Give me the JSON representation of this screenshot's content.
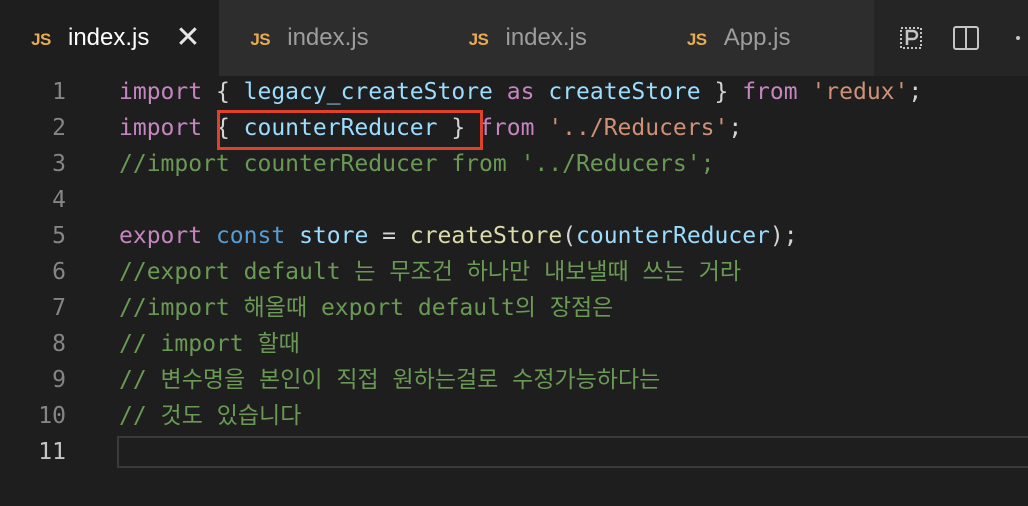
{
  "tabs": [
    {
      "icon": "JS",
      "label": "index.js",
      "active": true,
      "close": "✕"
    },
    {
      "icon": "JS",
      "label": "index.js",
      "active": false
    },
    {
      "icon": "JS",
      "label": "index.js",
      "active": false
    },
    {
      "icon": "JS",
      "label": "App.js",
      "active": false
    }
  ],
  "colors": {
    "keyword": "#c586c0",
    "storage": "#569cd6",
    "variable": "#9cdcfe",
    "function": "#dcdcaa",
    "string": "#ce9178",
    "comment": "#6a9955",
    "highlight_box": "#e0412b",
    "js_icon": "#e8ab53"
  },
  "editor": {
    "current_line": 11,
    "lines": [
      {
        "n": "1",
        "t": [
          "import",
          " { ",
          "legacy_createStore",
          " ",
          "as",
          " ",
          "createStore",
          " } ",
          "from",
          " ",
          "'redux'",
          ";"
        ]
      },
      {
        "n": "2",
        "t": [
          "import",
          " { ",
          "counterReducer",
          " } ",
          "from",
          " ",
          "'../Reducers'",
          ";"
        ]
      },
      {
        "n": "3",
        "t": [
          "//import counterReducer from '../Reducers';"
        ]
      },
      {
        "n": "4",
        "t": []
      },
      {
        "n": "5",
        "t": [
          "export",
          " ",
          "const",
          " ",
          "store",
          " = ",
          "createStore",
          "(",
          "counterReducer",
          ");"
        ]
      },
      {
        "n": "6",
        "t": [
          "//export default 는 무조건 하나만 내보낼때 쓰는 거라"
        ]
      },
      {
        "n": "7",
        "t": [
          "//import 해올때 export default의 장점은"
        ]
      },
      {
        "n": "8",
        "t": [
          "// import 할때"
        ]
      },
      {
        "n": "9",
        "t": [
          "// 변수명을 본인이 직접 원하는걸로 수정가능하다는"
        ]
      },
      {
        "n": "10",
        "t": [
          "// 것도 있습니다"
        ]
      },
      {
        "n": "11",
        "t": []
      }
    ]
  }
}
